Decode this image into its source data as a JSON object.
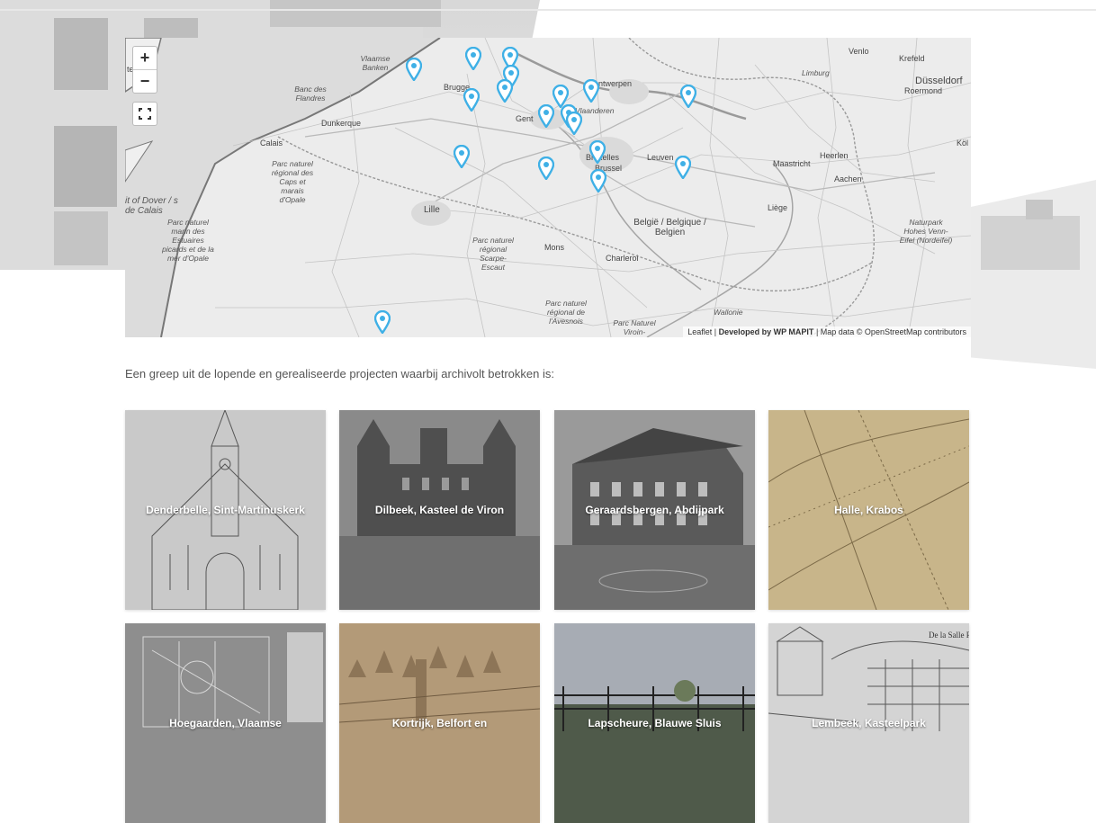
{
  "map": {
    "zoom_in": "+",
    "zoom_out": "−",
    "attribution": {
      "leaflet": "Leaflet",
      "sep1": " | ",
      "developed": "Developed by WP MAPIT",
      "rest": " | Map data © OpenStreetMap contributors"
    },
    "labels": {
      "canterbury": "terbury",
      "vlaamse_banken": "Vlaamse Banken",
      "banc": "Banc des Flandres",
      "dunkerque": "Dunkerque",
      "calais": "Calais",
      "parc_caps": "Parc naturel régional des Caps et marais d'Opale",
      "dover": "it of Dover / s de Calais",
      "parc_marin": "Parc naturel marin des Estuaires picards et de la mer d'Opale",
      "brugge": "Brugge",
      "gent": "Gent",
      "vlaanderen": "Vlaanderen",
      "antwerpen": "Antwerpen",
      "limburg": "Limburg",
      "venlo": "Venlo",
      "krefeld": "Krefeld",
      "roermond": "Roermond",
      "dusseldorf": "Düsseldorf",
      "kol": "Köl",
      "bruxelles": "Bruxelles",
      "brussel": "Brussel",
      "leuven": "Leuven",
      "maastricht": "Maastricht",
      "heerlen": "Heerlen",
      "aachen": "Aachen",
      "lille": "Lille",
      "belgie": "België / Belgique / Belgien",
      "liege": "Liège",
      "naturpark": "Naturpark Hohes Venn-Eifel (Nordeifel)",
      "parc_scarpe": "Parc naturel régional Scarpe-Escaut",
      "mons": "Mons",
      "charleroi": "Charleroi",
      "parc_avesnois": "Parc naturel régional de l'Avesnois",
      "parc_viroin": "Parc Naturel Viroin-Hermeton",
      "wallonie": "Wallonie"
    }
  },
  "intro": "Een greep uit de lopende en gerealiseerde projecten waarbij archivolt betrokken is:",
  "projects": [
    {
      "title": "Denderbelle, Sint-Martinuskerk",
      "bg": "#c9c9c9"
    },
    {
      "title": "Dilbeek, Kasteel de Viron",
      "bg": "#7a7a7a"
    },
    {
      "title": "Geraardsbergen, Abdijpark",
      "bg": "#888888"
    },
    {
      "title": "Halle, Krabos",
      "bg": "#c8b58a"
    },
    {
      "title": "Hoegaarden, Vlaamse",
      "bg": "#8e8e8e"
    },
    {
      "title": "Kortrijk, Belfort en",
      "bg": "#b39a78"
    },
    {
      "title": "Lapscheure, Blauwe Sluis",
      "bg": "#8a8d95"
    },
    {
      "title": "Lembeek, Kasteelpark",
      "bg": "#cfcfcf"
    }
  ]
}
